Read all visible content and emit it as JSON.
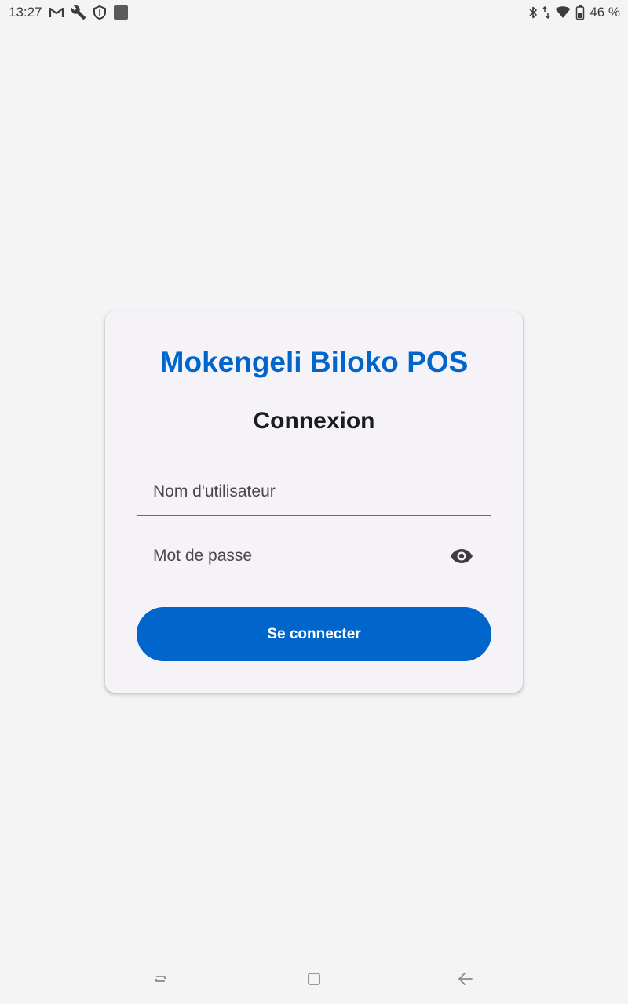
{
  "status_bar": {
    "time": "13:27",
    "battery": "46 %",
    "icons_left": [
      "gmail-icon",
      "wrench-icon",
      "shield-icon",
      "app-square-icon"
    ],
    "icons_right": [
      "bluetooth-icon",
      "data-arrows-icon",
      "wifi-icon",
      "battery-icon"
    ]
  },
  "login": {
    "app_title": "Mokengeli Biloko POS",
    "subtitle": "Connexion",
    "username_placeholder": "Nom d'utilisateur",
    "username_value": "",
    "password_placeholder": "Mot de passe",
    "password_value": "",
    "toggle_icon": "eye-icon",
    "submit_label": "Se connecter"
  },
  "nav_bar": {
    "buttons": [
      "recents-icon",
      "home-icon",
      "back-icon"
    ]
  },
  "colors": {
    "accent": "#0066cc",
    "background": "#f4f4f4",
    "card": "#f6f3f8",
    "text": "#1c1b1f"
  }
}
